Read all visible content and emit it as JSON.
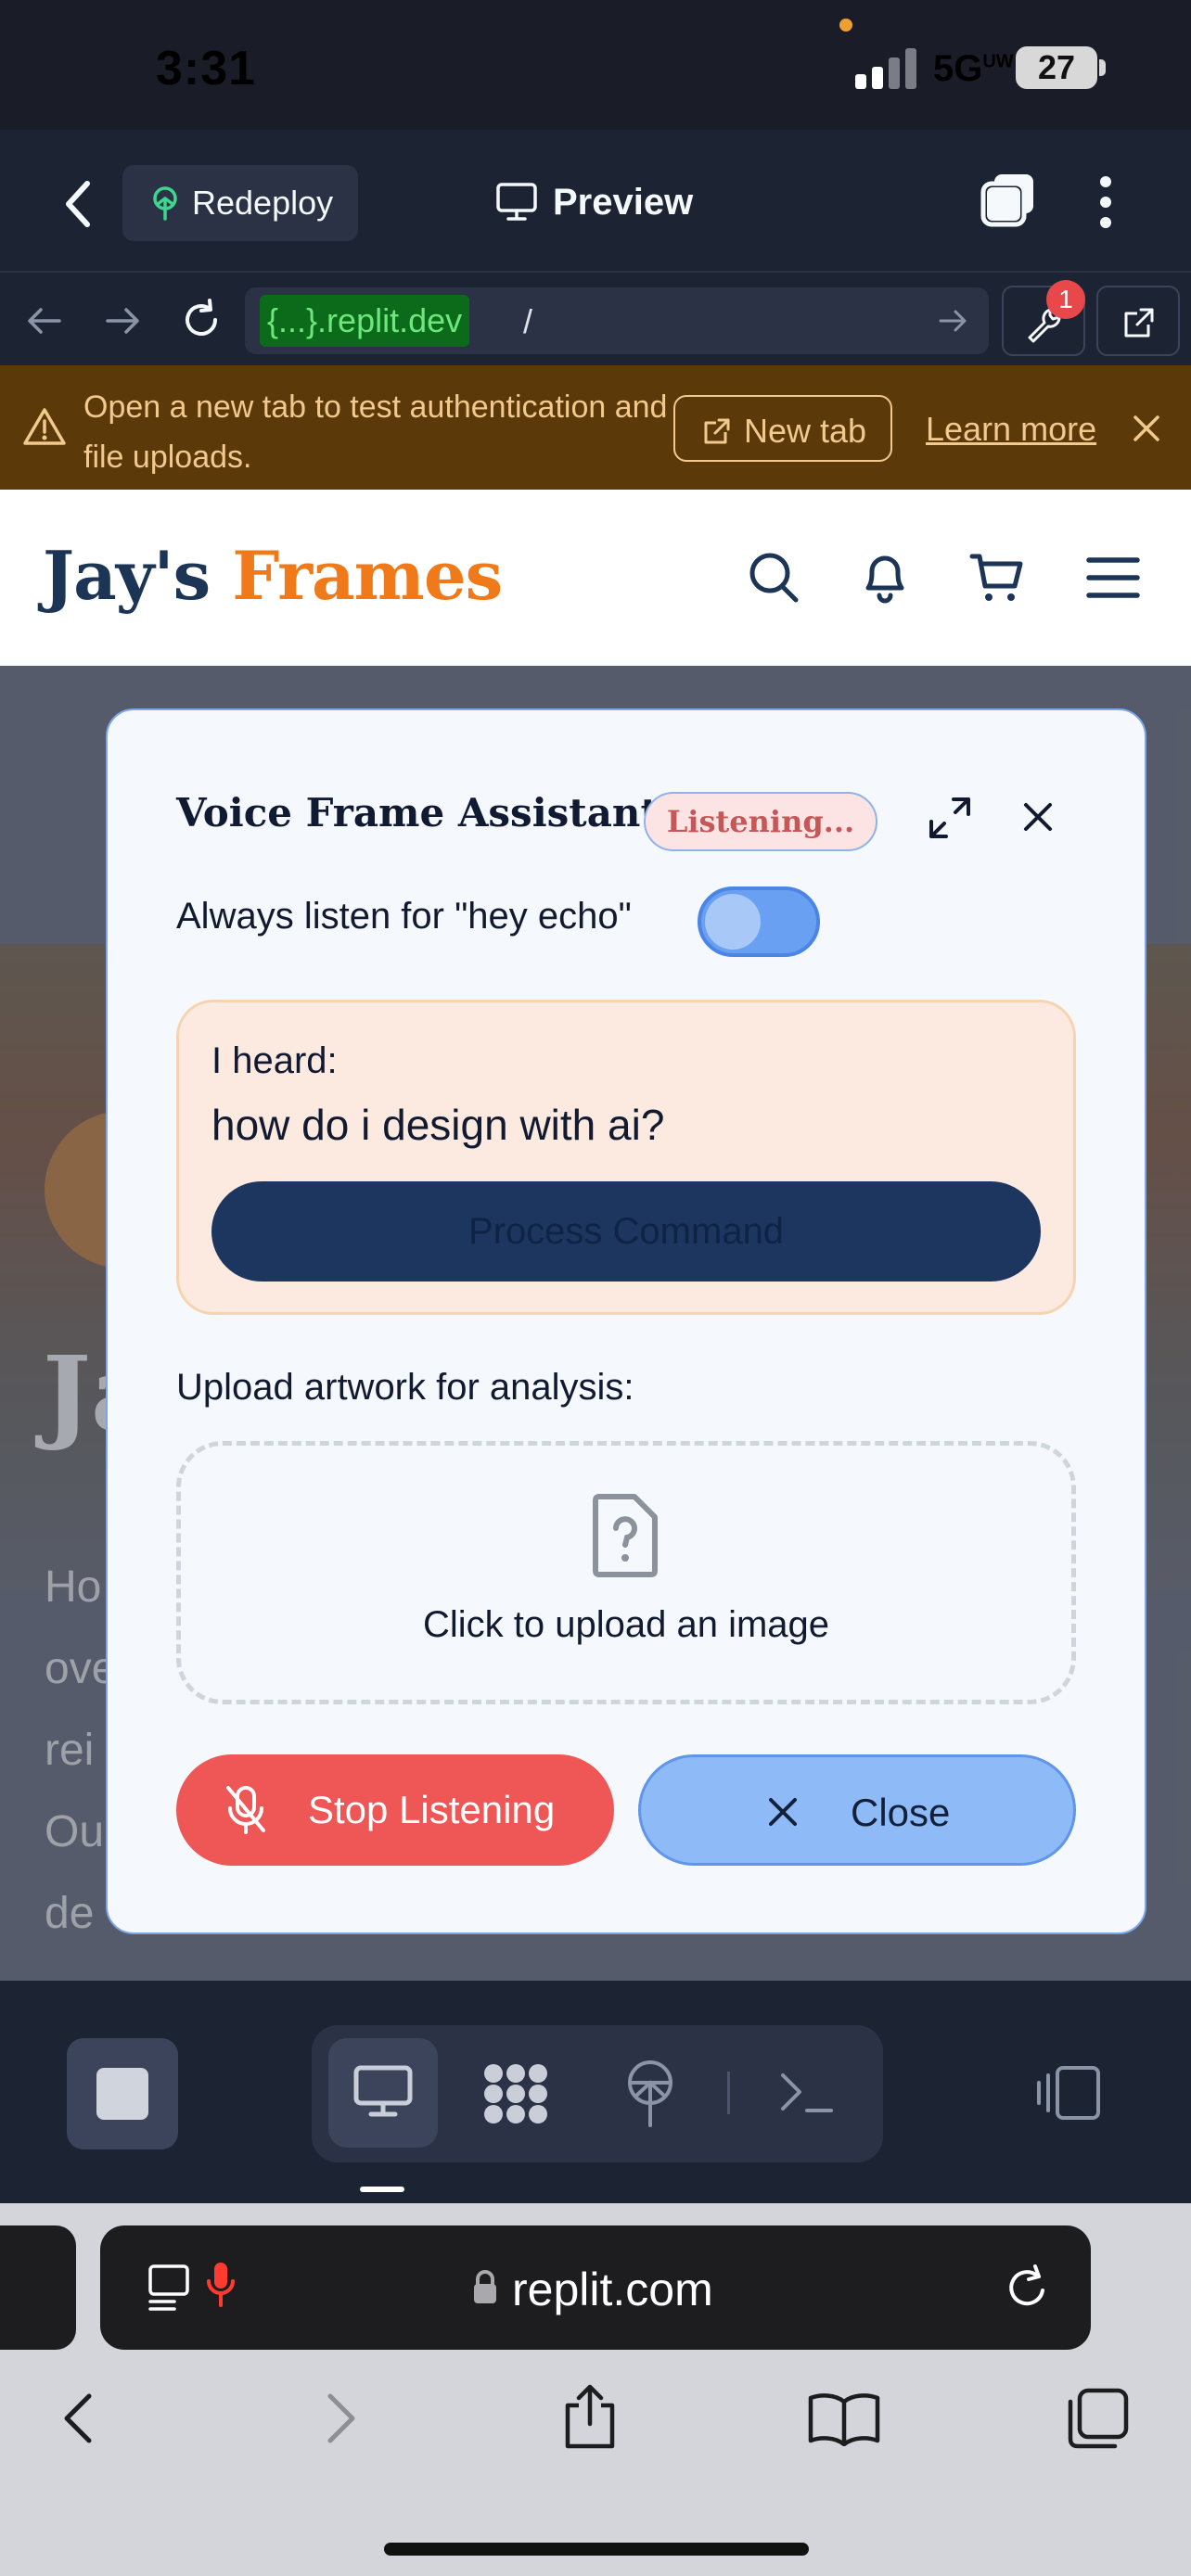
{
  "status_bar": {
    "time": "3:31",
    "network": "5G",
    "network_sup": "UW",
    "battery": "27"
  },
  "replit_header": {
    "redeploy_label": "Redeploy",
    "preview_label": "Preview"
  },
  "url_bar": {
    "url_host": "{...}.replit.dev",
    "url_path": "/",
    "devtools_badge": "1"
  },
  "banner": {
    "text": "Open a new tab to test authentication and file uploads.",
    "new_tab_label": "New tab",
    "learn_more_label": "Learn more"
  },
  "site": {
    "logo_part1": "Jay's",
    "logo_part2": "Frames",
    "hero_title": "Ja",
    "hero_body_lines": [
      "Ho",
      "ove",
      "rei",
      "Ou",
      "de"
    ]
  },
  "modal": {
    "title": "Voice Frame Assistant",
    "status_badge": "Listening...",
    "toggle_label": "Always listen for \"hey echo\"",
    "heard_label": "I heard:",
    "heard_text": "how do i design with ai?",
    "process_button": "Process Command",
    "upload_label": "Upload artwork for analysis:",
    "dropzone_text": "Click to upload an image",
    "stop_button": "Stop Listening",
    "close_button": "Close"
  },
  "safari": {
    "address": "replit.com"
  },
  "colors": {
    "brand_navy": "#1c3557",
    "brand_orange": "#f07a1a",
    "stop_red": "#ef5656",
    "close_blue": "#8fbaf8"
  }
}
